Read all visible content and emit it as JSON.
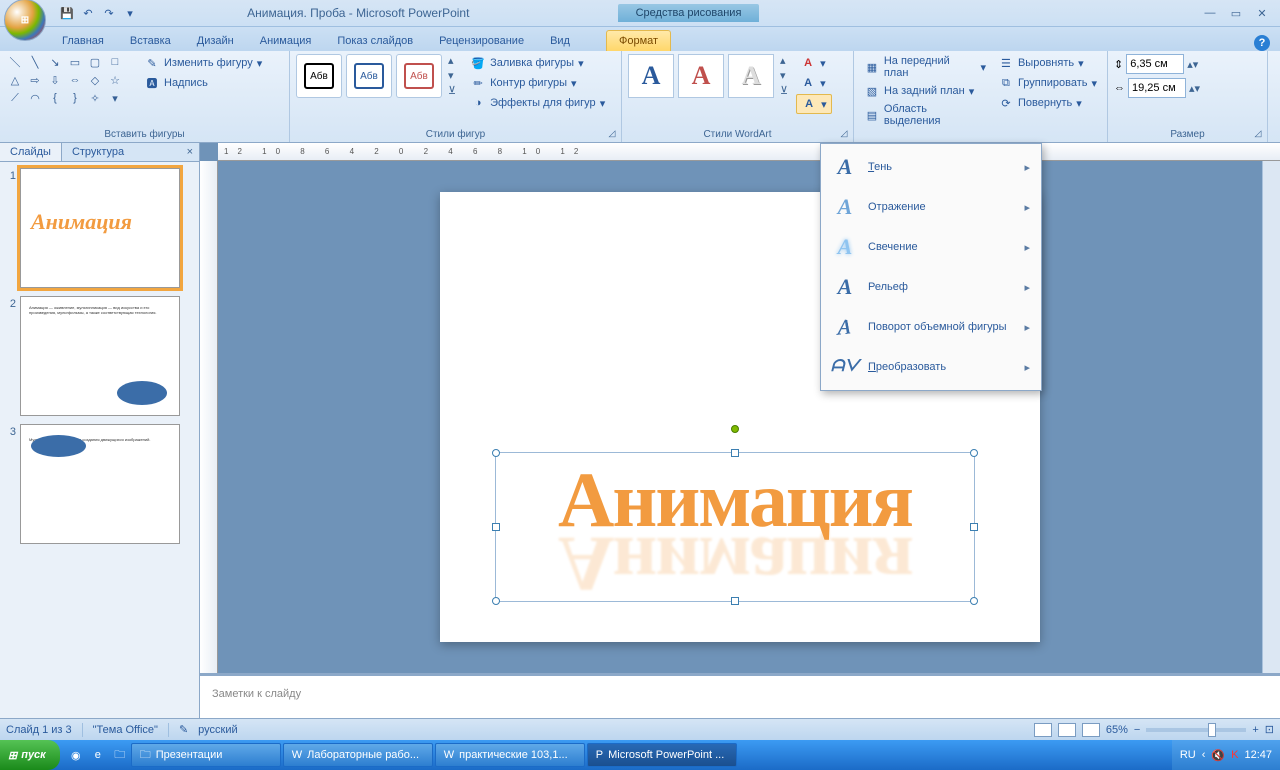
{
  "titlebar": {
    "title": "Анимация. Проба - Microsoft PowerPoint",
    "context": "Средства рисования"
  },
  "tabs": {
    "t0": "Главная",
    "t1": "Вставка",
    "t2": "Дизайн",
    "t3": "Анимация",
    "t4": "Показ слайдов",
    "t5": "Рецензирование",
    "t6": "Вид",
    "t7": "Формат"
  },
  "ribbon": {
    "insert_shapes": "Вставить фигуры",
    "edit_shape": "Изменить фигуру",
    "textbox": "Надпись",
    "shape_styles": "Стили фигур",
    "abv": "Абв",
    "shape_fill": "Заливка фигуры",
    "shape_outline": "Контур фигуры",
    "shape_effects": "Эффекты для фигур",
    "wordart_styles": "Стили WordArt",
    "arrange": {
      "front": "На передний план",
      "back": "На задний план",
      "selection": "Область выделения",
      "align": "Выровнять",
      "group": "Группировать",
      "rotate": "Повернуть"
    },
    "size": "Размер",
    "height": "6,35 см",
    "width": "19,25 см"
  },
  "slidepane": {
    "tab_slides": "Слайды",
    "tab_outline": "Структура",
    "wordart_text": "Анимация"
  },
  "fxmenu": {
    "shadow": "Тень",
    "reflection": "Отражение",
    "glow": "Свечение",
    "bevel": "Рельеф",
    "rotation3d": "Поворот объемной фигуры",
    "transform": "Преобразовать"
  },
  "notes": {
    "placeholder": "Заметки к слайду"
  },
  "status": {
    "slide": "Слайд 1 из 3",
    "theme": "\"Тема Office\"",
    "lang": "русский",
    "zoom": "65%"
  },
  "taskbar": {
    "start": "пуск",
    "b1": "Презентации",
    "b2": "Лабораторные рабо...",
    "b3": "практические 103,1...",
    "b4": "Microsoft PowerPoint ...",
    "lang": "RU",
    "time": "12:47"
  }
}
